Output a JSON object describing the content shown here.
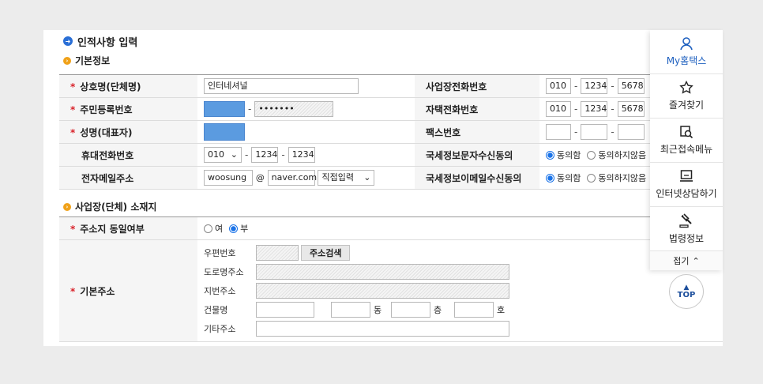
{
  "page": {
    "title": "인적사항 입력",
    "section_basic": "기본정보",
    "section_address": "사업장(단체) 소재지"
  },
  "basic": {
    "biz_name_label": "상호명(단체명)",
    "biz_name_value": "인터네셔널",
    "rrn_label": "주민등록번호",
    "rrn_masked": "•••••••",
    "name_label": "성명(대표자)",
    "mobile_label": "휴대전화번호",
    "mobile_prefix": "010",
    "mobile_mid": "1234",
    "mobile_last": "1234",
    "email_label": "전자메일주소",
    "email_id": "woosung",
    "email_at": "@",
    "email_domain": "naver.com",
    "email_select": "직접입력",
    "biz_phone_label": "사업장전화번호",
    "biz_phone": [
      "010",
      "1234",
      "5678"
    ],
    "home_phone_label": "자택전화번호",
    "home_phone": [
      "010",
      "1234",
      "5678"
    ],
    "fax_label": "팩스번호",
    "sms_consent_label": "국세정보문자수신동의",
    "email_consent_label": "국세정보이메일수신동의",
    "agree": "동의함",
    "disagree": "동의하지않음"
  },
  "address": {
    "same_label": "주소지 동일여부",
    "yes": "여",
    "no": "부",
    "base_label": "기본주소",
    "zip_label": "우편번호",
    "search_btn": "주소검색",
    "road_label": "도로명주소",
    "lot_label": "지번주소",
    "building_label": "건물명",
    "dong": "동",
    "floor": "층",
    "ho": "호",
    "etc_label": "기타주소"
  },
  "sidebar": {
    "items": [
      {
        "label": "My홈택스",
        "icon": "person-icon"
      },
      {
        "label": "즐겨찾기",
        "icon": "star-icon"
      },
      {
        "label": "최근접속메뉴",
        "icon": "recent-menu-icon"
      },
      {
        "label": "인터넷상담하기",
        "icon": "monitor-icon"
      },
      {
        "label": "법령정보",
        "icon": "gavel-icon"
      }
    ],
    "fold": "접기",
    "top": "TOP"
  }
}
